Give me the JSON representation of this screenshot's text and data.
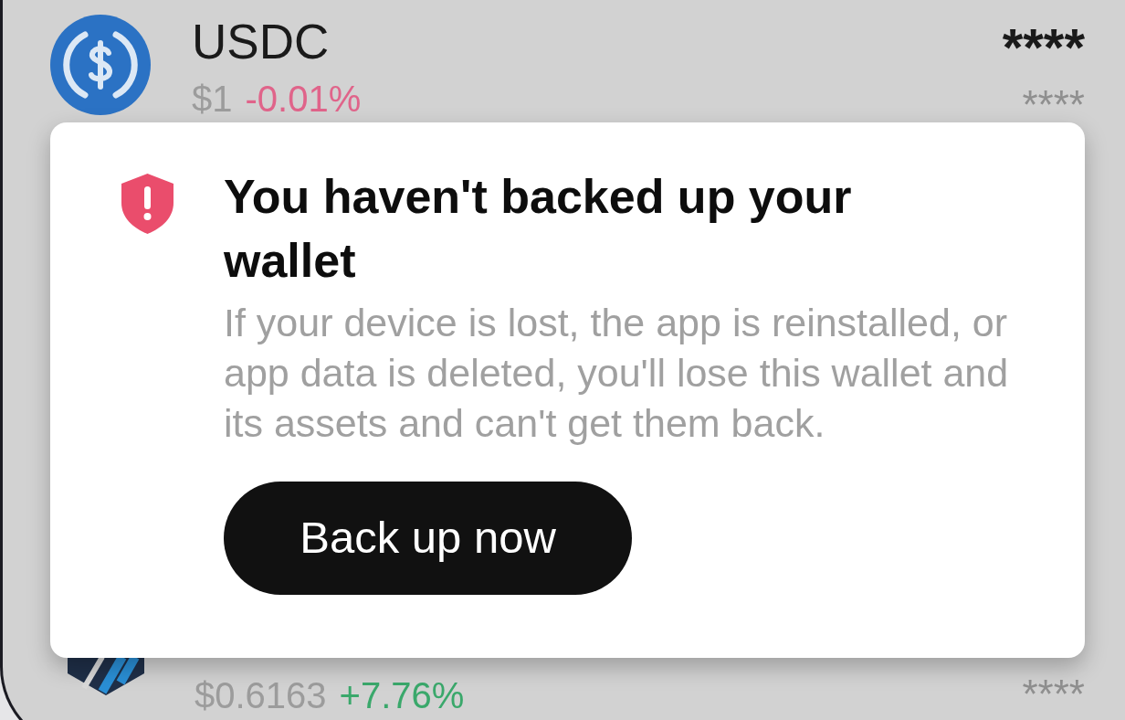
{
  "assets": [
    {
      "kind": "usdc",
      "symbol": "USDC",
      "price": "$1",
      "change": "-0.01%",
      "color": "#e0648a",
      "balance": "****",
      "value": "****"
    },
    {
      "kind": "arb",
      "price": "$0.6163",
      "change": "+7.76%",
      "color": "#3aa86b",
      "value": "****"
    }
  ],
  "backup_prompt": {
    "title": "You haven't backed up your wallet",
    "message": "If your device is lost, the app is reinstalled, or app data is deleted, you'll lose this wallet and its assets and can't get them back.",
    "button": "Back up now"
  }
}
